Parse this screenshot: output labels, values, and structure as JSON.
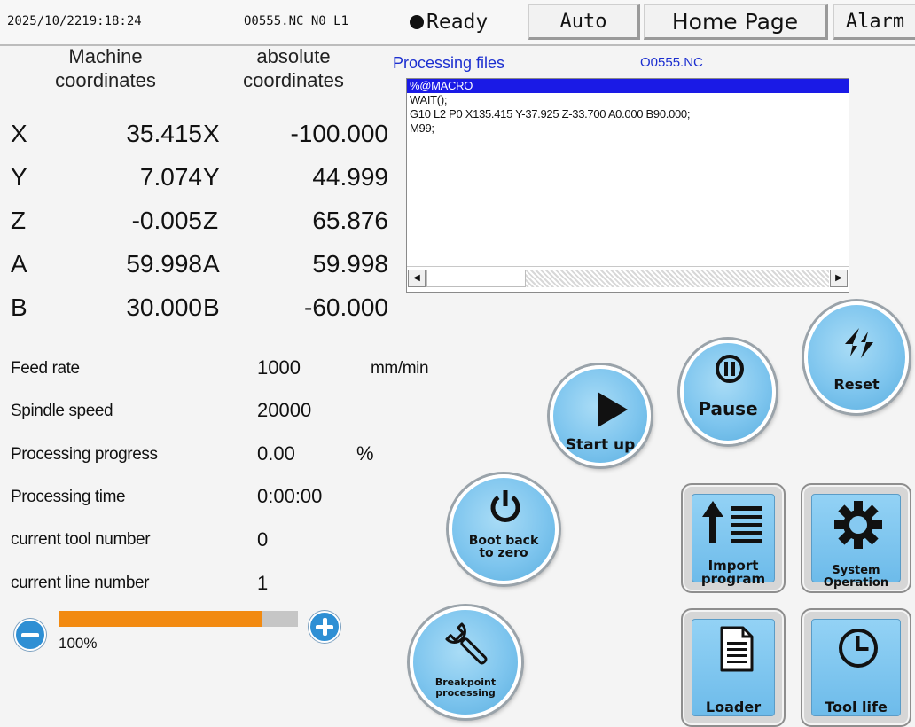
{
  "status_bar": {
    "datetime": "2025/10/2219:18:24",
    "program_info": "O0555.NC N0 L1",
    "status": "Ready",
    "mode": "Auto",
    "page": "Home Page",
    "alarm": "Alarm"
  },
  "coordinates": {
    "machine_header_line1": "Machine",
    "machine_header_line2": "coordinates",
    "absolute_header_line1": "absolute",
    "absolute_header_line2": "coordinates",
    "rows": [
      {
        "axis": "X",
        "machine": "35.415",
        "abs_axis": "X",
        "absolute": "-100.000"
      },
      {
        "axis": "Y",
        "machine": "7.074",
        "abs_axis": "Y",
        "absolute": "44.999"
      },
      {
        "axis": "Z",
        "machine": "-0.005",
        "abs_axis": "Z",
        "absolute": "65.876"
      },
      {
        "axis": "A",
        "machine": "59.998",
        "abs_axis": "A",
        "absolute": "59.998"
      },
      {
        "axis": "B",
        "machine": "30.000",
        "abs_axis": "B",
        "absolute": "-60.000"
      }
    ]
  },
  "files": {
    "title": "Processing files",
    "filename": "O0555.NC",
    "lines": [
      "%@MACRO",
      "WAIT();",
      "G10 L2 P0 X135.415 Y-37.925 Z-33.700 A0.000 B90.000;",
      "M99;"
    ],
    "selected_line": 0
  },
  "params": {
    "feed_label": "Feed rate",
    "feed_value": "1000",
    "feed_unit": "mm/min",
    "spindle_label": "Spindle speed",
    "spindle_value": "20000",
    "progress_label": "Processing progress",
    "progress_value": "0.00",
    "progress_unit": "%",
    "time_label": "Processing time",
    "time_value": "0:00:00",
    "tool_label": "current tool number",
    "tool_value": "0",
    "line_label": "current line number",
    "line_value": "1"
  },
  "override": {
    "label": "100%",
    "level": 0.85,
    "fill_color": "#f28a11"
  },
  "buttons": {
    "start": "Start up",
    "pause": "Pause",
    "reset": "Reset",
    "boot_back_1": "Boot back",
    "boot_back_2": "to zero",
    "breakpoint_1": "Breakpoint",
    "breakpoint_2": "processing",
    "import_1": "Import",
    "import_2": "program",
    "system_1": "System",
    "system_2": "Operation",
    "loader": "Loader",
    "tool_life": "Tool life"
  },
  "colors": {
    "button_blue": "#7ec5ee",
    "selection_blue": "#1a1ae6",
    "files_title_blue": "#1c2fd0"
  }
}
